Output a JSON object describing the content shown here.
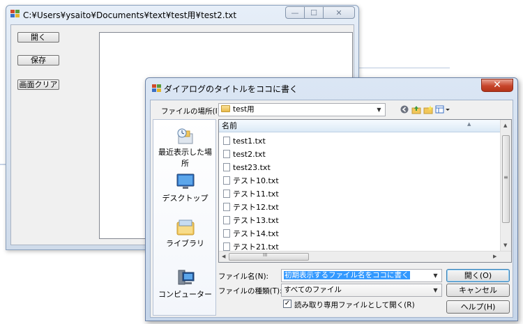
{
  "main_window": {
    "title": "C:¥Users¥ysaito¥Documents¥text¥test用¥test2.txt",
    "buttons": {
      "open": "開く",
      "save": "保存",
      "clear": "画面クリア"
    },
    "minimize_glyph": "—",
    "maximize_glyph": "☐",
    "close_glyph": "✕"
  },
  "dialog": {
    "title": "ダイアログのタイトルをココに書く",
    "close_glyph": "✕",
    "look_in_label": "ファイルの場所(I):",
    "look_in_value": "test用",
    "places": [
      {
        "label": "最近表示した場所",
        "icon": "recent-places-icon"
      },
      {
        "label": "デスクトップ",
        "icon": "desktop-icon"
      },
      {
        "label": "ライブラリ",
        "icon": "libraries-icon"
      },
      {
        "label": "コンピューター",
        "icon": "computer-icon"
      }
    ],
    "column_name": "名前",
    "files": [
      "test1.txt",
      "test2.txt",
      "test23.txt",
      "テスト10.txt",
      "テスト11.txt",
      "テスト12.txt",
      "テスト13.txt",
      "テスト14.txt",
      "テスト21.txt"
    ],
    "scroll_grip": "≡",
    "hscroll_grip": "III",
    "filename_label": "ファイル名(N):",
    "filename_value": "初期表示するファイル名をココに書く",
    "filetype_label": "ファイルの種類(T):",
    "filetype_value": "すべてのファイル",
    "readonly_label": "読み取り専用ファイルとして開く(R)",
    "readonly_checked": "✓",
    "open_button": "開く(O)",
    "cancel_button": "キャンセル",
    "help_button": "ヘルプ(H)"
  }
}
